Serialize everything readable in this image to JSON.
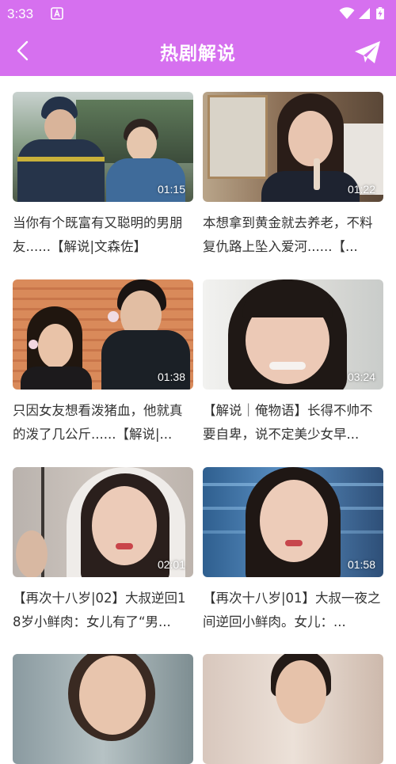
{
  "status": {
    "time": "3:33"
  },
  "header": {
    "title": "热剧解说"
  },
  "videos": [
    {
      "duration": "01:15",
      "title": "当你有个既富有又聪明的男朋友......【解说|文森佐】"
    },
    {
      "duration": "01:22",
      "title": "本想拿到黄金就去养老，不料复仇路上坠入爱河......【..."
    },
    {
      "duration": "01:38",
      "title": "只因女友想看泼猪血，他就真的泼了几公斤......【解说|..."
    },
    {
      "duration": "03:24",
      "title": "【解说｜俺物语】长得不帅不要自卑，说不定美少女早..."
    },
    {
      "duration": "02:01",
      "title": "【再次十八岁|02】大叔逆回18岁小鲜肉：女儿有了“男..."
    },
    {
      "duration": "01:58",
      "title": "【再次十八岁|01】大叔一夜之间逆回小鲜肉。女儿：..."
    }
  ],
  "colors": {
    "accent": "#d670ef",
    "text": "#333333"
  }
}
